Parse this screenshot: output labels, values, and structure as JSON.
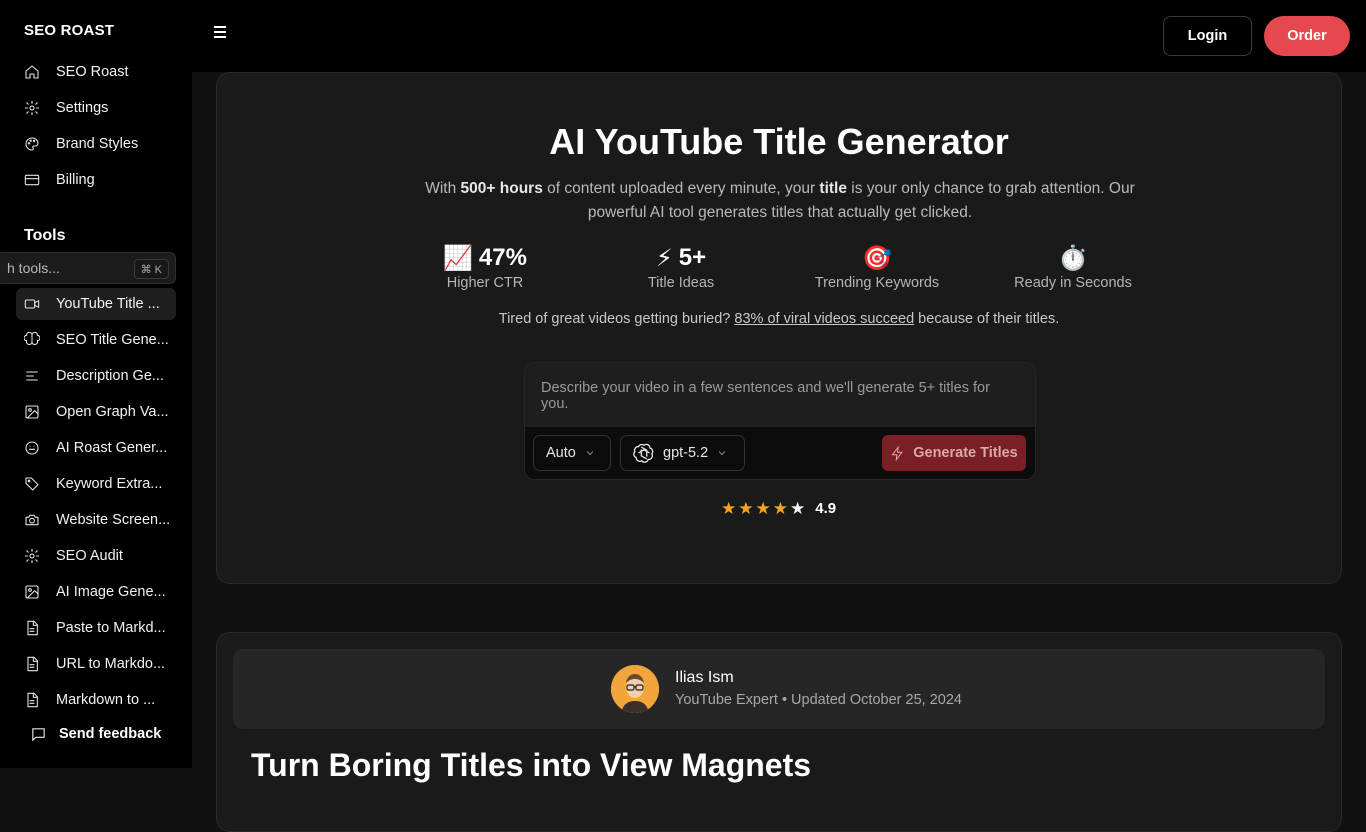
{
  "brand": "SEO ROAST",
  "sidebar": {
    "main_items": [
      {
        "label": "SEO Roast",
        "icon": "home-icon"
      },
      {
        "label": "Settings",
        "icon": "gear-icon"
      },
      {
        "label": "Brand Styles",
        "icon": "palette-icon"
      },
      {
        "label": "Billing",
        "icon": "credit-card-icon"
      }
    ],
    "tools_heading": "Tools",
    "search_placeholder": "h tools...",
    "search_shortcut": "⌘ K",
    "tools": [
      {
        "label": "YouTube Title ...",
        "icon": "video-icon",
        "active": true
      },
      {
        "label": "SEO Title Gene...",
        "icon": "brain-icon"
      },
      {
        "label": "Description Ge...",
        "icon": "text-lines-icon"
      },
      {
        "label": "Open Graph Va...",
        "icon": "image-icon"
      },
      {
        "label": "AI Roast Gener...",
        "icon": "smile-icon"
      },
      {
        "label": "Keyword Extra...",
        "icon": "tag-icon"
      },
      {
        "label": "Website Screen...",
        "icon": "camera-icon"
      },
      {
        "label": "SEO Audit",
        "icon": "gear-icon"
      },
      {
        "label": "AI Image Gene...",
        "icon": "image-icon"
      },
      {
        "label": "Paste to Markd...",
        "icon": "file-icon"
      },
      {
        "label": "URL to Markdo...",
        "icon": "file-icon"
      },
      {
        "label": "Markdown to ...",
        "icon": "file-icon"
      }
    ],
    "feedback": "Send feedback"
  },
  "topbar": {
    "login": "Login",
    "order": "Order"
  },
  "hero": {
    "title": "AI YouTube Title Generator",
    "sub_1": "With ",
    "sub_b1": "500+ hours",
    "sub_2": " of content uploaded every minute, your ",
    "sub_b2": "title",
    "sub_3": " is your only chance to grab attention. Our powerful AI tool generates titles that actually get clicked.",
    "stats": [
      {
        "emoji": "📈",
        "value": "47%",
        "label": "Higher CTR"
      },
      {
        "emoji": "⚡",
        "value": "5+",
        "label": "Title Ideas"
      },
      {
        "emoji": "🎯",
        "value": "",
        "label": "Trending Keywords"
      },
      {
        "emoji": "⏱️",
        "value": "",
        "label": "Ready in Seconds"
      }
    ],
    "tired_pre": "Tired of great videos getting buried? ",
    "tired_link": "83% of viral videos succeed",
    "tired_post": " because of their titles.",
    "prompt_placeholder": "Describe your video in a few sentences and we'll generate 5+ titles for you.",
    "mode_select": "Auto",
    "model_select": "gpt-5.2",
    "generate": "Generate Titles",
    "rating": "4.9",
    "rating_stars": 4.5
  },
  "author": {
    "name": "Ilias Ism",
    "meta": "YouTube Expert • Updated October 25, 2024"
  },
  "article_heading": "Turn Boring Titles into View Magnets",
  "colors": {
    "accent": "#e5484d",
    "generate_bg": "#7a1f23",
    "star": "#f5a524",
    "avatar_bg": "#f1a53a"
  }
}
